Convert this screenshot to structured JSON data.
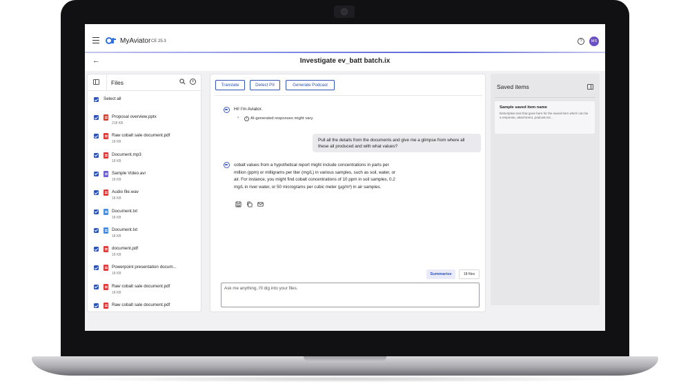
{
  "app": {
    "name": "MyAviator",
    "version": "CE 25.3",
    "avatar_initials": "MS",
    "help_glyph": "?"
  },
  "page": {
    "title": "Investigate ev_batt batch.ix",
    "back_glyph": "←"
  },
  "files_panel": {
    "title": "Files",
    "select_all_label": "Select all",
    "add_glyph": "+",
    "files": [
      {
        "name": "Proposal overview.pptx",
        "size": "218 KB",
        "type": "pptx",
        "icon": "pptx-file-icon",
        "color": "#d04a3a"
      },
      {
        "name": "Raw cobalt sale document.pdf",
        "size": "18 KB",
        "type": "pdf",
        "icon": "pdf-file-icon",
        "color": "#e03c3c"
      },
      {
        "name": "Document.mp3",
        "size": "18 KB",
        "type": "mp3",
        "icon": "audio-file-icon",
        "color": "#e03c3c"
      },
      {
        "name": "Sample Video.avi",
        "size": "18 KB",
        "type": "avi",
        "icon": "video-file-icon",
        "color": "#6b5fd3"
      },
      {
        "name": "Audio file.wav",
        "size": "18 KB",
        "type": "wav",
        "icon": "audio-file-icon",
        "color": "#e03c3c"
      },
      {
        "name": "Document.txt",
        "size": "18 KB",
        "type": "txt",
        "icon": "text-file-icon",
        "color": "#4a8de0"
      },
      {
        "name": "Document.txt",
        "size": "18 KB",
        "type": "txt",
        "icon": "text-file-icon",
        "color": "#4a8de0"
      },
      {
        "name": "document.pdf",
        "size": "18 KB",
        "type": "pdf",
        "icon": "pdf-file-icon",
        "color": "#e03c3c"
      },
      {
        "name": "Powerpoint presentation docum...",
        "size": "18 KB",
        "type": "pptx",
        "icon": "pptx-file-icon",
        "color": "#e03c3c"
      },
      {
        "name": "Raw cobalt sale document.pdf",
        "size": "18 KB",
        "type": "pdf",
        "icon": "pdf-file-icon",
        "color": "#e03c3c"
      },
      {
        "name": "Raw cobalt sale document.pdf",
        "size": "",
        "type": "pdf",
        "icon": "pdf-file-icon",
        "color": "#e03c3c"
      }
    ]
  },
  "chat": {
    "actions": [
      "Translate",
      "Detect PII",
      "Generate Podcast"
    ],
    "greeting": "Hi! I'm Aviator.",
    "disclaimer": "AI-generated responses might vary.",
    "disclaimer_chevron": "›",
    "info_glyph": "i",
    "user_message": "Pull all the details from the documents and give me a glimpse from where all these all produced and with what values?",
    "bot_answer": "cobalt values from a hypothetical report might include concentrations in parts per million (ppm) or milligrams per liter (mg/L) in various samples, such as soil, water, or air. For instance, you might find cobalt concentrations of 10 ppm in soil samples, 0.2 mg/L in river water, or 50 micrograms per cubic meter (µg/m³) in air samples.",
    "summarise_label": "Summarise",
    "files_count": "18 files",
    "input_placeholder": "Ask me anything, I'll dig into your files."
  },
  "saved_panel": {
    "title": "Saved items",
    "card_title": "Sample saved item name",
    "card_description": "Description text that goes here for the saved item which can be a response, attachment, podcast etc.."
  },
  "colors": {
    "accent": "#2d52b8",
    "avatar": "#6a4fc4"
  }
}
